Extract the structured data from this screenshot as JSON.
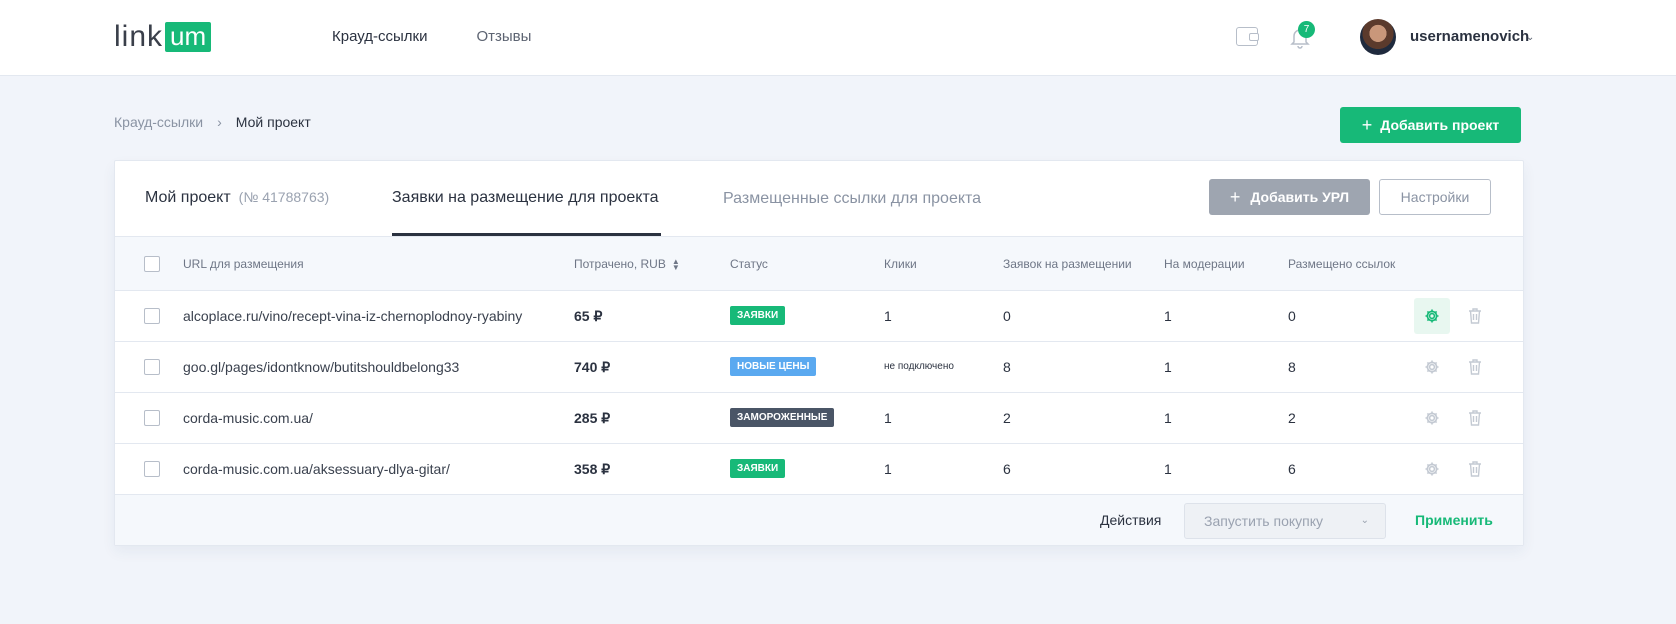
{
  "header": {
    "logo_text": "link",
    "logo_accent": "um",
    "nav": [
      "Крауд-ссылки",
      "Отзывы"
    ],
    "notifications_count": "7",
    "username": "usernamenovich"
  },
  "breadcrumb": {
    "parent": "Крауд-ссылки",
    "separator": "›",
    "current": "Мой проект"
  },
  "add_project_label": "Добавить проект",
  "tabs": {
    "project_name": "Мой проект",
    "project_number": "(№ 41788763)",
    "requests": "Заявки на размещение для проекта",
    "placed": "Размещенные ссылки для проекта"
  },
  "buttons": {
    "add_url": "Добавить УРЛ",
    "settings": "Настройки"
  },
  "table": {
    "columns": [
      "URL для размещения",
      "Потрачено, RUB",
      "Статус",
      "Клики",
      "Заявок на размещении",
      "На модерации",
      "Размещено ссылок"
    ],
    "rows": [
      {
        "url": "alcoplace.ru/vino/recept-vina-iz-chernoplodnoy-ryabiny",
        "spent": "65 ₽",
        "status": "заявки",
        "status_color": "#17b978",
        "clicks": "1",
        "requests": "0",
        "moderation": "1",
        "placed": "0"
      },
      {
        "url": "goo.gl/pages/idontknow/butitshouldbelong33",
        "spent": "740 ₽",
        "status": "новые цены",
        "status_color": "#5aa9f0",
        "clicks": "не подключено",
        "requests": "8",
        "moderation": "1",
        "placed": "8"
      },
      {
        "url": "corda-music.com.ua/",
        "spent": "285 ₽",
        "status": "замороженные",
        "status_color": "#4a5566",
        "clicks": "1",
        "requests": "2",
        "moderation": "1",
        "placed": "2"
      },
      {
        "url": "corda-music.com.ua/aksessuary-dlya-gitar/",
        "spent": "358 ₽",
        "status": "заявки",
        "status_color": "#17b978",
        "clicks": "1",
        "requests": "6",
        "moderation": "1",
        "placed": "6"
      }
    ]
  },
  "footer": {
    "actions_label": "Действия",
    "select_value": "Запустить покупку",
    "apply_label": "Применить"
  },
  "colors": {
    "accent": "#17b978",
    "dark": "#2b3240",
    "muted": "#8a93a3"
  },
  "icons": [
    "wallet-icon",
    "bell-icon",
    "chevron-down-icon",
    "plus-icon",
    "sort-icon",
    "gear-icon",
    "trash-icon"
  ]
}
